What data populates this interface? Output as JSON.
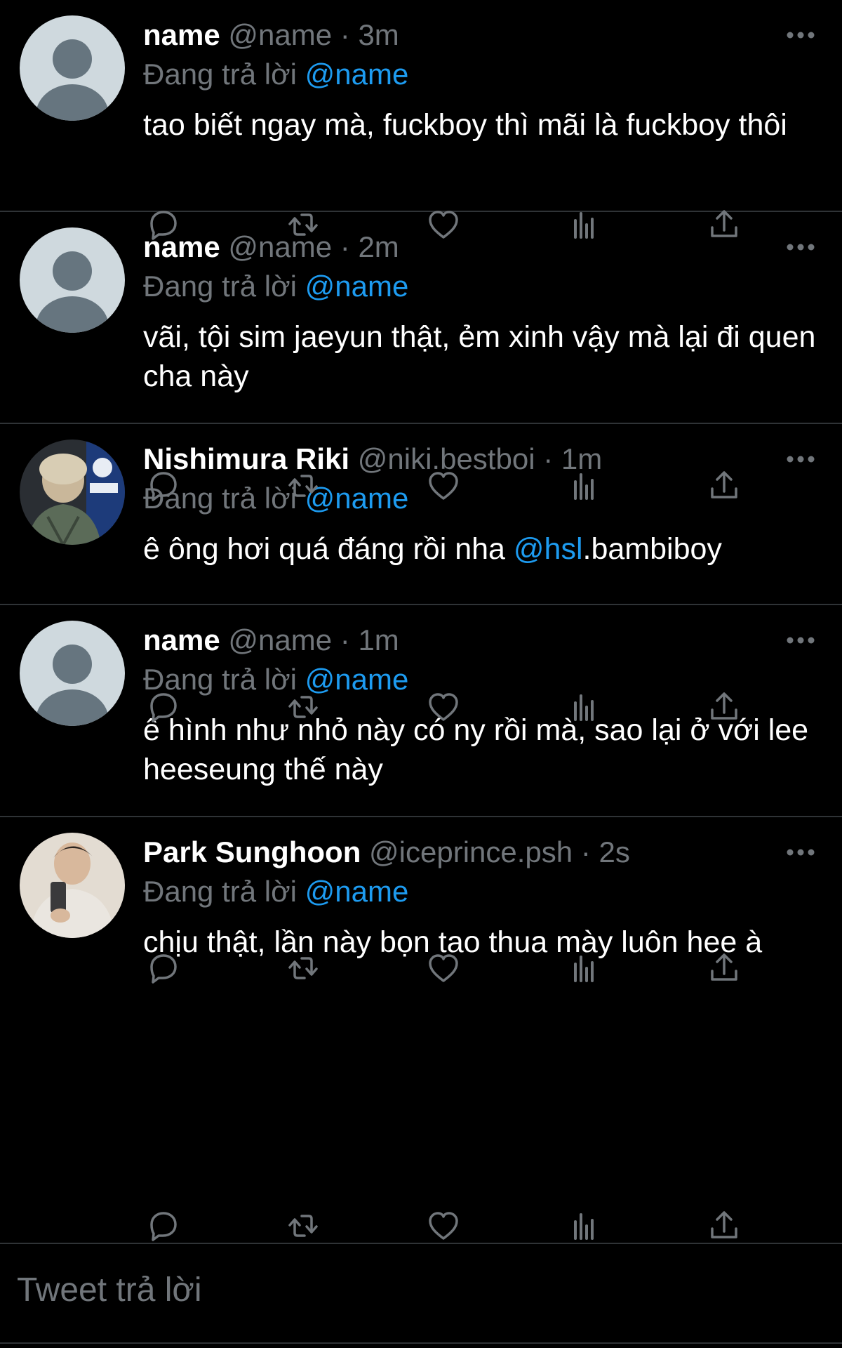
{
  "colors": {
    "background": "#000000",
    "text": "#ffffff",
    "muted": "#71767b",
    "accent": "#1d9bf0",
    "divider": "#2f3336"
  },
  "reply_prefix": "Đang trả lời",
  "tweets": [
    {
      "avatar": "default-avatar",
      "display_name": "name",
      "handle": "@name",
      "separator": "·",
      "time": "3m",
      "reply_to": "@name",
      "text": "tao biết ngay mà, fuckboy thì mãi là fuckboy thôi"
    },
    {
      "avatar": "default-avatar",
      "display_name": "name",
      "handle": "@name",
      "separator": "·",
      "time": "2m",
      "reply_to": "@name",
      "text": "vãi, tội sim jaeyun thật, ẻm xinh vậy mà lại đi quen cha này"
    },
    {
      "avatar": "photo-avatar",
      "display_name": "Nishimura Riki",
      "handle": "@niki.bestboi",
      "separator": "·",
      "time": "1m",
      "reply_to": "@name",
      "text_before": "ê ông hơi quá đáng rồi nha ",
      "text_mention": "@hsl",
      "text_after": ".bambiboy"
    },
    {
      "avatar": "default-avatar",
      "display_name": "name",
      "handle": "@name",
      "separator": "·",
      "time": "1m",
      "reply_to": "@name",
      "text": "ê hình như nhỏ này có ny rồi mà, sao lại ở với lee heeseung thế này"
    },
    {
      "avatar": "photo-avatar",
      "display_name": "Park Sunghoon",
      "handle": "@iceprince.psh",
      "separator": "·",
      "time": "2s",
      "reply_to": "@name",
      "text": "chịu thật, lần này bọn tao thua mày luôn hee à"
    }
  ],
  "action_icons": [
    "reply-icon",
    "retweet-icon",
    "like-icon",
    "analytics-icon",
    "share-icon"
  ],
  "reply_box": {
    "placeholder": "Tweet trả lời"
  }
}
